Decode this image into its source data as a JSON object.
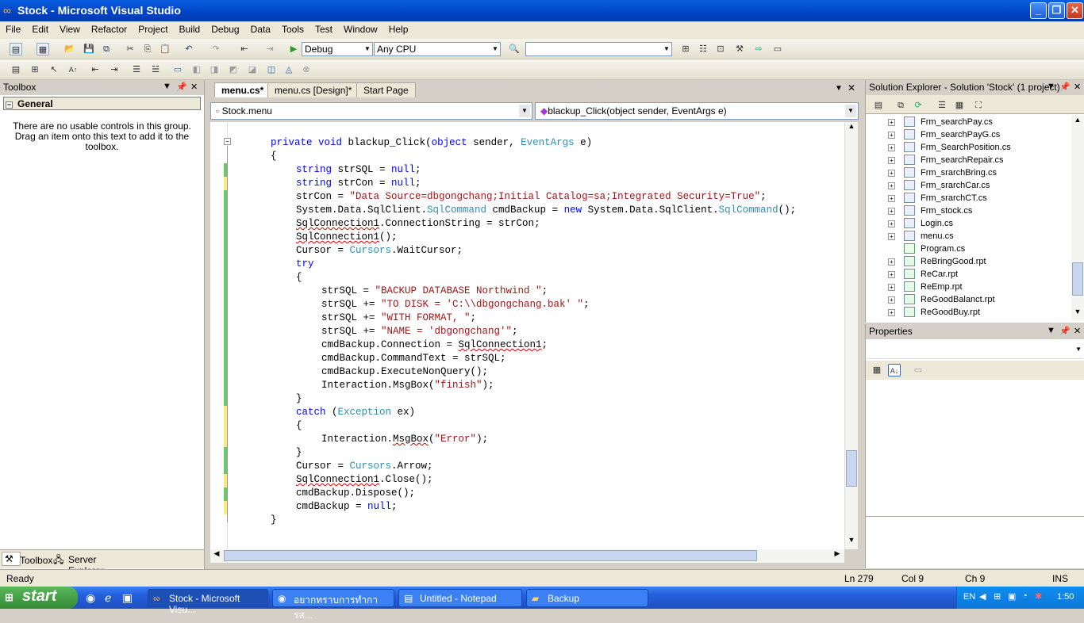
{
  "window": {
    "title": "Stock - Microsoft Visual Studio"
  },
  "menu": [
    "File",
    "Edit",
    "View",
    "Refactor",
    "Project",
    "Build",
    "Debug",
    "Data",
    "Tools",
    "Test",
    "Window",
    "Help"
  ],
  "toolbar": {
    "config": "Debug",
    "platform": "Any CPU",
    "find": ""
  },
  "toolbox": {
    "title": "Toolbox",
    "group": "General",
    "message": "There are no usable controls in this group. Drag an item onto this text to add it to the toolbox.",
    "tabs": [
      "Toolbox",
      "Server Explorer"
    ]
  },
  "editor": {
    "tabs": [
      "menu.cs*",
      "menu.cs [Design]*",
      "Start Page"
    ],
    "class_combo": "Stock.menu",
    "member_combo": "blackup_Click(object sender, EventArgs e)"
  },
  "code_lines": [
    "private void blackup_Click(object sender, EventArgs e)",
    "{",
    "string strSQL = null;",
    "string strCon = null;",
    "strCon = \"Data Source=dbgongchang;Initial Catalog=sa;Integrated Security=True\";",
    "System.Data.SqlClient.SqlCommand cmdBackup = new System.Data.SqlClient.SqlCommand();",
    "SqlConnection1.ConnectionString = strCon;",
    "SqlConnection1();",
    "Cursor = Cursors.WaitCursor;",
    "try",
    "{",
    "strSQL = \"BACKUP DATABASE Northwind \";",
    "strSQL += \"TO DISK = 'C:\\\\dbgongchang.bak' \";",
    "strSQL += \"WITH FORMAT, \";",
    "strSQL += \"NAME = 'dbgongchang'\";",
    "cmdBackup.Connection = SqlConnection1;",
    "cmdBackup.CommandText = strSQL;",
    "cmdBackup.ExecuteNonQuery();",
    "Interaction.MsgBox(\"finish\");",
    "}",
    "catch (Exception ex)",
    "{",
    "Interaction.MsgBox(\"Error\");",
    "}",
    "Cursor = Cursors.Arrow;",
    "SqlConnection1.Close();",
    "cmdBackup.Dispose();",
    "cmdBackup = null;",
    "}"
  ],
  "solution_explorer": {
    "title": "Solution Explorer - Solution 'Stock' (1 project)",
    "items": [
      "Frm_searchPay.cs",
      "Frm_searchPayG.cs",
      "Frm_SearchPosition.cs",
      "Frm_searchRepair.cs",
      "Frm_srarchBring.cs",
      "Frm_srarchCar.cs",
      "Frm_srarchCT.cs",
      "Frm_stock.cs",
      "Login.cs",
      "menu.cs",
      "Program.cs",
      "ReBringGood.rpt",
      "ReCar.rpt",
      "ReEmp.rpt",
      "ReGoodBalanct.rpt",
      "ReGoodBuy.rpt"
    ]
  },
  "properties": {
    "title": "Properties"
  },
  "status": {
    "text": "Ready",
    "ln": "Ln 279",
    "col": "Col 9",
    "ch": "Ch 9",
    "mode": "INS"
  },
  "taskbar": {
    "start": "start",
    "tasks": [
      "Stock - Microsoft Visu...",
      "อยากทราบการทำการส...",
      "Untitled - Notepad",
      "Backup"
    ],
    "lang": "EN",
    "clock": "1:50"
  }
}
